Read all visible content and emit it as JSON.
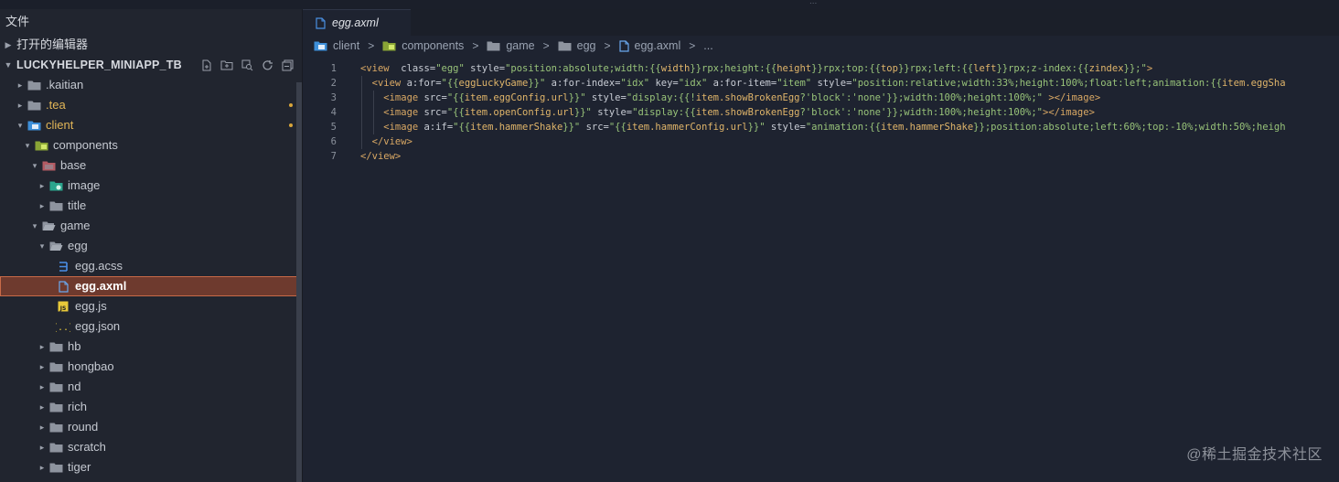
{
  "window": {
    "overflow_glyph": "..."
  },
  "sidebar": {
    "title": "文件",
    "open_editors": "打开的编辑器",
    "project": "LUCKYHELPER_MINIAPP_TB",
    "tree": [
      {
        "label": ".kaitian",
        "depth": 0,
        "twisty": "▸",
        "icon": "folder-icon",
        "modified": false
      },
      {
        "label": ".tea",
        "depth": 0,
        "twisty": "▸",
        "icon": "folder-icon",
        "modified": true
      },
      {
        "label": "client",
        "depth": 0,
        "twisty": "▾",
        "icon": "folder-client-icon",
        "modified": true
      },
      {
        "label": "components",
        "depth": 1,
        "twisty": "▾",
        "icon": "folder-components-icon",
        "modified": false
      },
      {
        "label": "base",
        "depth": 2,
        "twisty": "▾",
        "icon": "folder-base-icon",
        "modified": false
      },
      {
        "label": "image",
        "depth": 3,
        "twisty": "▸",
        "icon": "folder-image-icon",
        "modified": false
      },
      {
        "label": "title",
        "depth": 3,
        "twisty": "▸",
        "icon": "folder-icon",
        "modified": false
      },
      {
        "label": "game",
        "depth": 2,
        "twisty": "▾",
        "icon": "folder-open-icon",
        "modified": false
      },
      {
        "label": "egg",
        "depth": 3,
        "twisty": "▾",
        "icon": "folder-open-icon",
        "modified": false
      },
      {
        "label": "egg.acss",
        "depth": 4,
        "twisty": "",
        "icon": "css-file-icon",
        "modified": false
      },
      {
        "label": "egg.axml",
        "depth": 4,
        "twisty": "",
        "icon": "axml-file-icon",
        "modified": false,
        "selected": true
      },
      {
        "label": "egg.js",
        "depth": 4,
        "twisty": "",
        "icon": "js-file-icon",
        "modified": false
      },
      {
        "label": "egg.json",
        "depth": 4,
        "twisty": "",
        "icon": "json-file-icon",
        "modified": false
      },
      {
        "label": "hb",
        "depth": 3,
        "twisty": "▸",
        "icon": "folder-icon",
        "modified": false
      },
      {
        "label": "hongbao",
        "depth": 3,
        "twisty": "▸",
        "icon": "folder-icon",
        "modified": false
      },
      {
        "label": "nd",
        "depth": 3,
        "twisty": "▸",
        "icon": "folder-icon",
        "modified": false
      },
      {
        "label": "rich",
        "depth": 3,
        "twisty": "▸",
        "icon": "folder-icon",
        "modified": false
      },
      {
        "label": "round",
        "depth": 3,
        "twisty": "▸",
        "icon": "folder-icon",
        "modified": false
      },
      {
        "label": "scratch",
        "depth": 3,
        "twisty": "▸",
        "icon": "folder-icon",
        "modified": false
      },
      {
        "label": "tiger",
        "depth": 3,
        "twisty": "▸",
        "icon": "folder-icon",
        "modified": false
      }
    ]
  },
  "editor": {
    "tab_label": "egg.axml",
    "breadcrumb": [
      "client",
      "components",
      "game",
      "egg",
      "egg.axml",
      "..."
    ],
    "lines": [
      [
        [
          "tag",
          "<view"
        ],
        [
          "attr",
          "  class="
        ],
        [
          "str",
          "\"egg\""
        ],
        [
          "attr",
          " style="
        ],
        [
          "str",
          "\"position:absolute;width:{{"
        ],
        [
          "exp",
          "width"
        ],
        [
          "str",
          "}}rpx;height:{{"
        ],
        [
          "exp",
          "height"
        ],
        [
          "str",
          "}}rpx;top:{{"
        ],
        [
          "exp",
          "top"
        ],
        [
          "str",
          "}}rpx;left:{{"
        ],
        [
          "exp",
          "left"
        ],
        [
          "str",
          "}}rpx;z-index:{{"
        ],
        [
          "exp",
          "zindex"
        ],
        [
          "str",
          "}};\""
        ],
        [
          "tag",
          ">"
        ]
      ],
      [
        [
          "tag",
          "  <view"
        ],
        [
          "attr",
          " a:for="
        ],
        [
          "str",
          "\"{{"
        ],
        [
          "exp",
          "eggLuckyGame"
        ],
        [
          "str",
          "}}\""
        ],
        [
          "attr",
          " a:for-index="
        ],
        [
          "str",
          "\"idx\""
        ],
        [
          "attr",
          " key="
        ],
        [
          "str",
          "\"idx\""
        ],
        [
          "attr",
          " a:for-item="
        ],
        [
          "str",
          "\"item\""
        ],
        [
          "attr",
          " style="
        ],
        [
          "str",
          "\"position:relative;width:33%;height:100%;float:left;animation:{{"
        ],
        [
          "exp",
          "item.eggSha"
        ]
      ],
      [
        [
          "tag",
          "    <image"
        ],
        [
          "attr",
          " src="
        ],
        [
          "str",
          "\"{{"
        ],
        [
          "exp",
          "item.eggConfig.url"
        ],
        [
          "str",
          "}}\""
        ],
        [
          "attr",
          " style="
        ],
        [
          "str",
          "\"display:{{!"
        ],
        [
          "exp",
          "item.showBrokenEgg"
        ],
        [
          "str",
          "?'block':'none'}};width:100%;height:100%;\""
        ],
        [
          "tag",
          " ></image>"
        ]
      ],
      [
        [
          "tag",
          "    <image"
        ],
        [
          "attr",
          " src="
        ],
        [
          "str",
          "\"{{"
        ],
        [
          "exp",
          "item.openConfig.url"
        ],
        [
          "str",
          "}}\""
        ],
        [
          "attr",
          " style="
        ],
        [
          "str",
          "\"display:{{"
        ],
        [
          "exp",
          "item.showBrokenEgg"
        ],
        [
          "str",
          "?'block':'none'}};width:100%;height:100%;\""
        ],
        [
          "tag",
          "></image>"
        ]
      ],
      [
        [
          "tag",
          "    <image"
        ],
        [
          "attr",
          " a:if="
        ],
        [
          "str",
          "\"{{"
        ],
        [
          "exp",
          "item.hammerShake"
        ],
        [
          "str",
          "}}\""
        ],
        [
          "attr",
          " src="
        ],
        [
          "str",
          "\"{{"
        ],
        [
          "exp",
          "item.hammerConfig.url"
        ],
        [
          "str",
          "}}\""
        ],
        [
          "attr",
          " style="
        ],
        [
          "str",
          "\"animation:{{"
        ],
        [
          "exp",
          "item.hammerShake"
        ],
        [
          "str",
          "}};position:absolute;left:60%;top:-10%;width:50%;heigh"
        ]
      ],
      [
        [
          "tag",
          "  </view>"
        ]
      ],
      [
        [
          "tag",
          "</view>"
        ]
      ]
    ]
  },
  "watermark": "@稀土掘金技术社区"
}
